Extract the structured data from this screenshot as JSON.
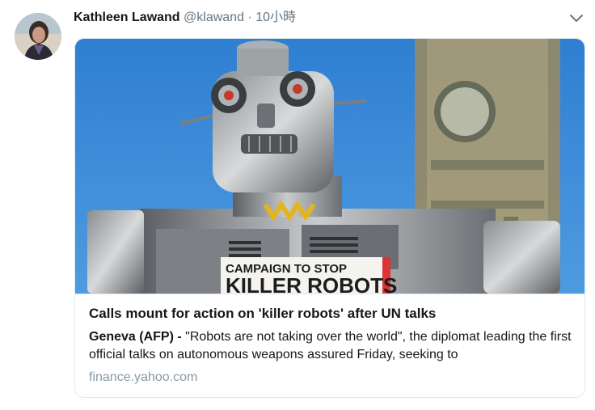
{
  "tweet": {
    "author_name": "Kathleen Lawand",
    "handle": "@klawand",
    "separator": "·",
    "time": "10小時"
  },
  "card": {
    "sign_line1": "CAMPAIGN TO STOP",
    "sign_line2": "KILLER ROBOTS",
    "title": "Calls mount for action on 'killer robots' after UN talks",
    "desc_source": "Geneva (AFP) -",
    "desc_text": " \"Robots are not taking over the world\", the diplomat leading the first official talks on autonomous weapons assured Friday, seeking to",
    "domain": "finance.yahoo.com"
  },
  "icons": {
    "menu": "chevron-down-icon"
  }
}
